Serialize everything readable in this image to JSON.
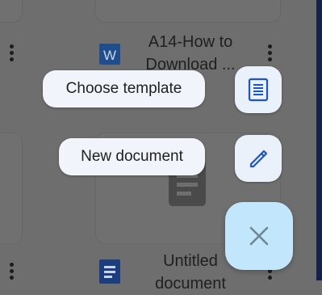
{
  "background_files": {
    "item_1": {
      "title_lines": [
        "A14-How to",
        "Download ..."
      ],
      "icon": "word-file-icon"
    },
    "item_2": {
      "title_lines": [
        "Untitled",
        "document"
      ],
      "icon": "docs-file-icon"
    }
  },
  "fab_menu": {
    "items": [
      {
        "label": "Choose template",
        "icon": "template-icon"
      },
      {
        "label": "New document",
        "icon": "pencil-icon"
      }
    ],
    "close_icon": "close-icon"
  },
  "colors": {
    "scrim": "#6e6e6e",
    "pill_bg": "#f1f4fa",
    "mini_fab_bg": "#eaf1fb",
    "main_fab_bg": "#c2e6fb",
    "icon_blue": "#1a56c8"
  }
}
